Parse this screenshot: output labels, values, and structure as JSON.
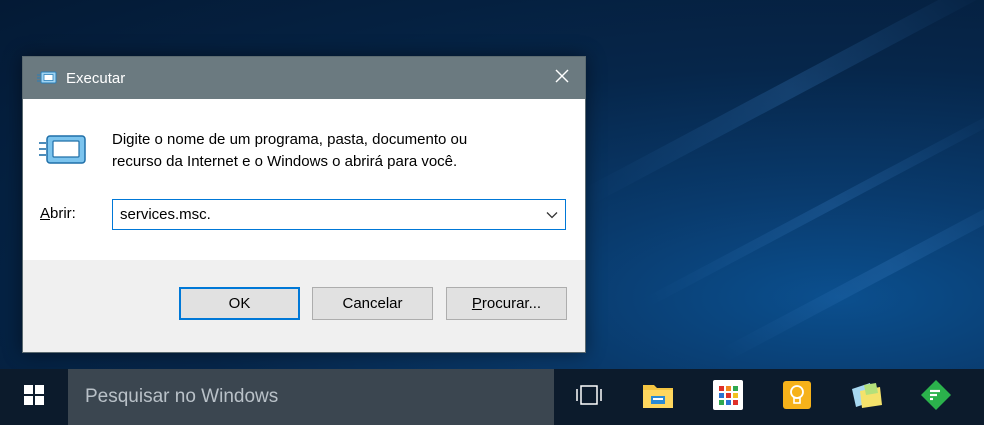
{
  "dialog": {
    "title": "Executar",
    "message_line1": "Digite o nome de um programa, pasta, documento ou",
    "message_line2": "recurso da Internet e o Windows o abrirá para você.",
    "open_label_mnemonic": "A",
    "open_label_rest": "brir:",
    "input_value": "services.msc.",
    "buttons": {
      "ok": "OK",
      "cancel": "Cancelar",
      "browse_mnemonic": "P",
      "browse_rest": "rocurar..."
    }
  },
  "taskbar": {
    "search_placeholder": "Pesquisar no Windows",
    "icons": [
      "windows-start-icon",
      "task-view-icon",
      "file-explorer-icon",
      "store-apps-icon",
      "lightbulb-tips-icon",
      "sticky-notes-icon",
      "feedly-icon"
    ]
  },
  "colors": {
    "titlebar": "#6b7a80",
    "accent": "#0078d7",
    "taskbar": "#0c1b2c",
    "search_box": "#3b4650"
  }
}
